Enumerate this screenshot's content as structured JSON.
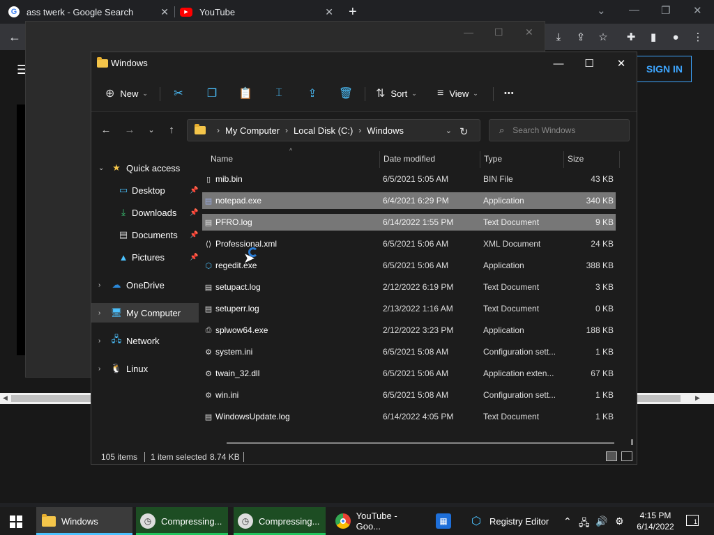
{
  "chrome": {
    "tabs": [
      {
        "title": "ass twerk - Google Search",
        "icon": "google-icon"
      },
      {
        "title": "YouTube",
        "icon": "youtube-icon"
      }
    ],
    "new_tab": "+",
    "sign_in": "SIGN IN"
  },
  "explorer": {
    "title": "Windows",
    "cmd": {
      "new": "New",
      "sort": "Sort",
      "view": "View",
      "more": "•••"
    },
    "address": {
      "crumbs": [
        "My Computer",
        "Local Disk (C:)",
        "Windows"
      ]
    },
    "search_placeholder": "Search Windows",
    "nav": {
      "quick_access": "Quick access",
      "desktop": "Desktop",
      "downloads": "Downloads",
      "documents": "Documents",
      "pictures": "Pictures",
      "onedrive": "OneDrive",
      "my_computer": "My Computer",
      "network": "Network",
      "linux": "Linux"
    },
    "columns": {
      "name": "Name",
      "date": "Date modified",
      "type": "Type",
      "size": "Size"
    },
    "files": [
      {
        "name": "mib.bin",
        "date": "6/5/2021 5:05 AM",
        "type": "BIN File",
        "size": "43 KB",
        "icon": "file-icon",
        "selected": false
      },
      {
        "name": "notepad.exe",
        "date": "6/4/2021 6:29 PM",
        "type": "Application",
        "size": "340 KB",
        "icon": "notepad-icon",
        "selected": true
      },
      {
        "name": "PFRO.log",
        "date": "6/14/2022 1:55 PM",
        "type": "Text Document",
        "size": "9 KB",
        "icon": "text-file-icon",
        "selected": true
      },
      {
        "name": "Professional.xml",
        "date": "6/5/2021 5:06 AM",
        "type": "XML Document",
        "size": "24 KB",
        "icon": "xml-file-icon",
        "selected": false
      },
      {
        "name": "regedit.exe",
        "date": "6/5/2021 5:06 AM",
        "type": "Application",
        "size": "388 KB",
        "icon": "regedit-icon",
        "selected": false
      },
      {
        "name": "setupact.log",
        "date": "2/12/2022 6:19 PM",
        "type": "Text Document",
        "size": "3 KB",
        "icon": "text-file-icon",
        "selected": false
      },
      {
        "name": "setuperr.log",
        "date": "2/13/2022 1:16 AM",
        "type": "Text Document",
        "size": "0 KB",
        "icon": "text-file-icon",
        "selected": false
      },
      {
        "name": "splwow64.exe",
        "date": "2/12/2022 3:23 PM",
        "type": "Application",
        "size": "188 KB",
        "icon": "printer-icon",
        "selected": false
      },
      {
        "name": "system.ini",
        "date": "6/5/2021 5:08 AM",
        "type": "Configuration sett...",
        "size": "1 KB",
        "icon": "config-file-icon",
        "selected": false
      },
      {
        "name": "twain_32.dll",
        "date": "6/5/2021 5:06 AM",
        "type": "Application exten...",
        "size": "67 KB",
        "icon": "dll-file-icon",
        "selected": false
      },
      {
        "name": "win.ini",
        "date": "6/5/2021 5:08 AM",
        "type": "Configuration sett...",
        "size": "1 KB",
        "icon": "config-file-icon",
        "selected": false
      },
      {
        "name": "WindowsUpdate.log",
        "date": "6/14/2022 4:05 PM",
        "type": "Text Document",
        "size": "1 KB",
        "icon": "text-file-icon",
        "selected": false
      }
    ],
    "status": {
      "items": "105 items",
      "selected": "1 item selected",
      "size": "8.74 KB"
    }
  },
  "taskbar": {
    "apps": [
      {
        "label": "Windows",
        "icon": "folder-icon"
      },
      {
        "label": "Compressing...",
        "icon": "clock-icon"
      },
      {
        "label": "Compressing...",
        "icon": "clock-icon"
      },
      {
        "label": "YouTube - Goo...",
        "icon": "chrome-icon"
      },
      {
        "label": "",
        "icon": "app-icon"
      },
      {
        "label": "Registry Editor",
        "icon": "regedit-icon"
      }
    ],
    "time": "4:15 PM",
    "date": "6/14/2022",
    "notif_count": "1"
  },
  "colors": {
    "accent": "#4cc2ff",
    "selection": "#777777",
    "progress_green": "#1d4d23",
    "youtube_red": "#ff0000",
    "signin_blue": "#3ea6ff"
  }
}
